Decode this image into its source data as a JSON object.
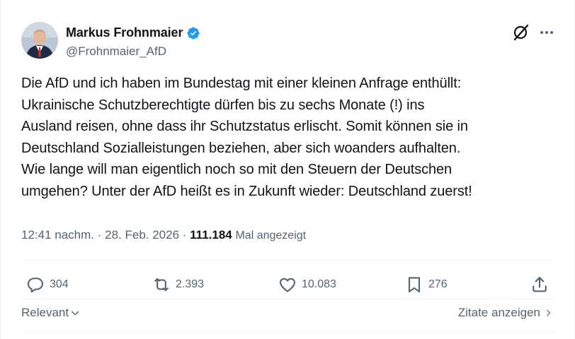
{
  "author": {
    "name": "Markus Frohnmaier",
    "handle": "@Frohnmaier_AfD",
    "verified": true,
    "verified_color": "#1d9bf0"
  },
  "tweet": {
    "text": "Die AfD und ich haben im Bundestag mit einer kleinen Anfrage enthüllt:\nUkrainische Schutzberechtigte dürfen bis zu sechs Monate (!) ins\nAusland reisen, ohne dass ihr Schutzstatus erlischt. Somit können sie in\nDeutschland Sozialleistungen beziehen, aber sich woanders aufhalten.\nWie lange will man eigentlich noch so mit den Steuern der Deutschen\numgehen? Unter der AfD heißt es in Zukunft wieder: Deutschland zuerst!"
  },
  "meta": {
    "time": "12:41 nachm.",
    "separator1": " · ",
    "date": "28. Feb. 2026",
    "separator2": " · ",
    "views_count": "111.184",
    "views_label": "Mal angezeigt"
  },
  "actions": {
    "replies": "304",
    "reposts": "2.393",
    "likes": "10.083",
    "bookmarks": "276"
  },
  "footer": {
    "sort_label": "Relevant",
    "quotes_label": "Zitate anzeigen"
  },
  "icons": {
    "grok": "grok-icon",
    "more": "more-icon",
    "reply": "reply-icon",
    "repost": "repost-icon",
    "like": "heart-icon",
    "bookmark": "bookmark-icon",
    "share": "share-icon"
  }
}
